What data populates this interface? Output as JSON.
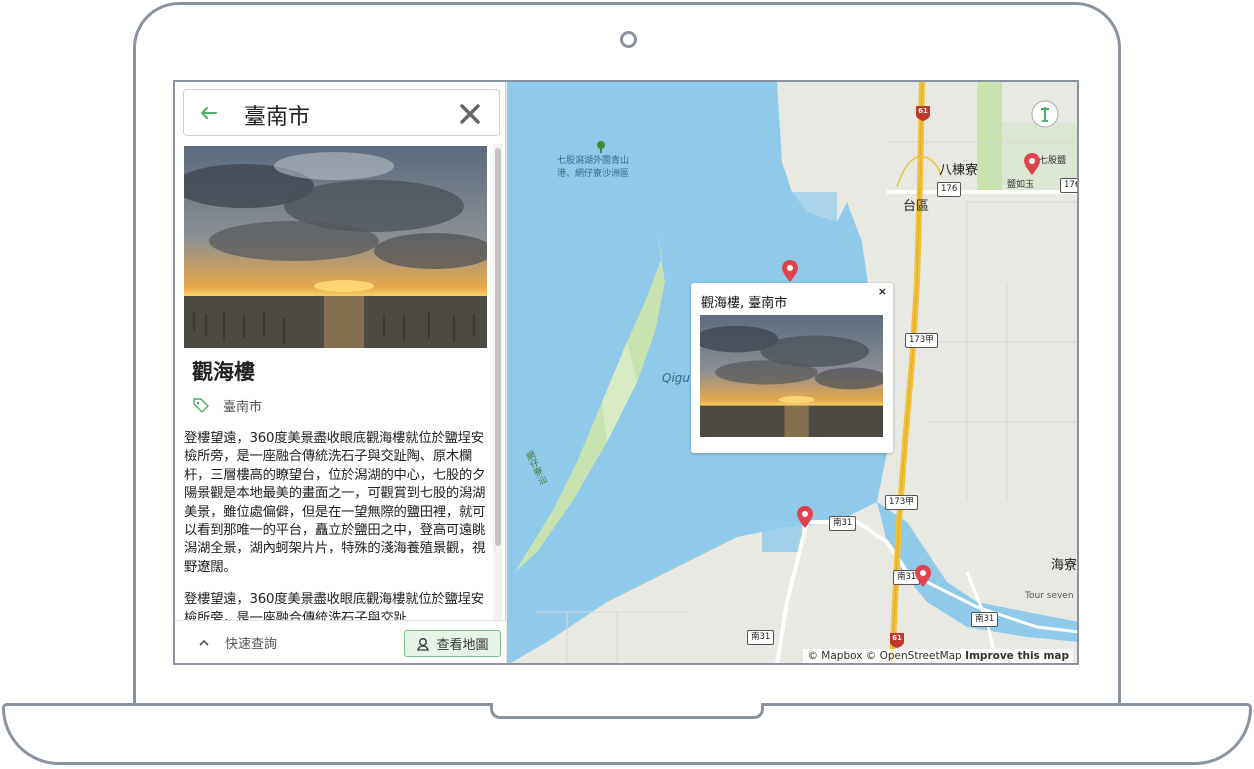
{
  "search": {
    "query": "臺南市"
  },
  "place": {
    "title": "觀海樓",
    "category": "臺南市",
    "paragraphs": [
      "登樓望遠，360度美景盡收眼底觀海樓就位於鹽埕安檢所旁，是一座融合傳統洗石子與交趾陶、原木欄杆，三層樓高的瞭望台，位於潟湖的中心，七股的夕陽景觀是本地最美的畫面之一，可觀賞到七股的潟湖美景，雖位處偏僻，但是在一望無際的鹽田裡，就可以看到那唯一的平台，矗立於鹽田之中，登高可遠眺潟湖全景，湖內蚵架片片，特殊的淺海養殖景觀，視野遼闊。",
      "登樓望遠，360度美景盡收眼底觀海樓就位於鹽埕安檢所旁，是一座融合傳統洗石子與交趾"
    ]
  },
  "bottom": {
    "quick_label": "快速查詢",
    "map_button": "查看地圖"
  },
  "popup": {
    "title": "觀海樓, 臺南市",
    "close": "×"
  },
  "map": {
    "labels": {
      "park": "七股潟湖外圍青山",
      "park2": "港、網仔寮沙洲區",
      "bajia": "八棟寮",
      "taiqu": "台區",
      "qigu": "Qigu",
      "wangzai": "網仔寮汕",
      "haibian": "海寮",
      "tour": "Tour seven",
      "qigu_salt": "七股鹽",
      "yanru": "鹽如玉"
    },
    "roads": {
      "r61": "61",
      "r176": "176",
      "r173a": "173甲",
      "r173b": "173甲",
      "nan31a": "南31",
      "nan31b": "南31",
      "nan31c": "南31",
      "nan31d": "南31",
      "nan31e": "南31",
      "r61b": "61"
    },
    "attribution": {
      "mapbox": "© Mapbox",
      "osm": "© OpenStreetMap",
      "improve": "Improve this map"
    }
  },
  "colors": {
    "water": "#8fcaeb",
    "land": "#e9e9e4",
    "green": "#c8e2b0",
    "accent": "#4caf6a",
    "marker": "#e0434b",
    "highway": "#f0c23a"
  }
}
